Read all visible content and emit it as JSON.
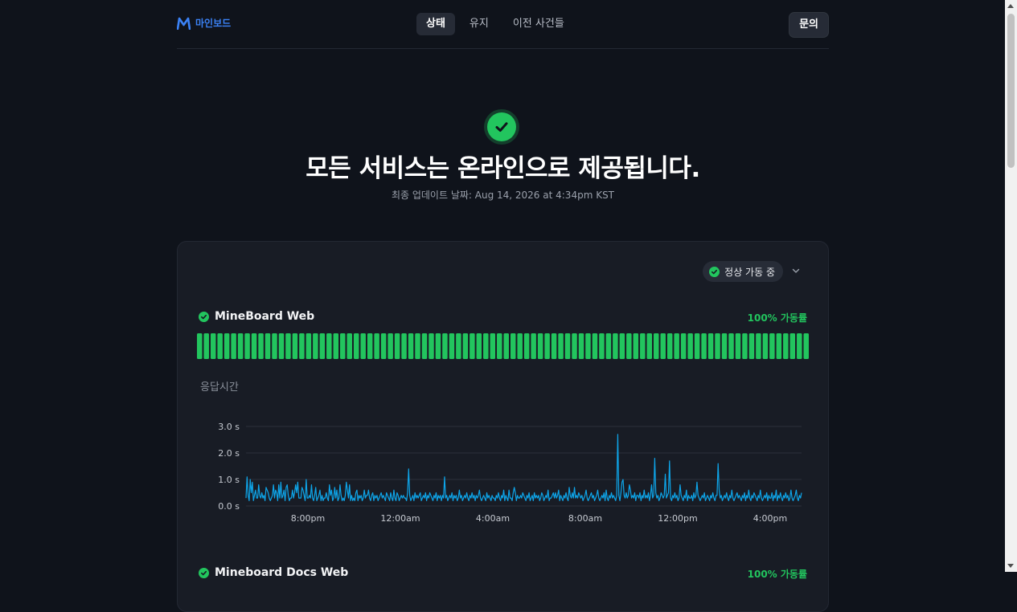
{
  "header": {
    "brand": "마인보드",
    "tabs": [
      {
        "label": "상태",
        "active": true
      },
      {
        "label": "유지",
        "active": false
      },
      {
        "label": "이전 사건들",
        "active": false
      }
    ],
    "contact_label": "문의"
  },
  "hero": {
    "title": "모든 서비스는 온라인으로 제공됩니다.",
    "last_updated": "최종 업데이트 날짜: Aug 14, 2026 at 4:34pm KST"
  },
  "card": {
    "status_filter": "정상 가동 중",
    "services": [
      {
        "name": "MineBoard Web",
        "uptime": "100% 가동률",
        "bar_count": 90,
        "status": "operational",
        "icon": "check-circle-icon"
      },
      {
        "name": "Mineboard Docs Web",
        "uptime": "100% 가동률",
        "status": "operational",
        "icon": "check-circle-icon"
      }
    ],
    "response_time_label": "응답시간"
  },
  "colors": {
    "background": "#0f131b",
    "card": "#181c25",
    "accent": "#3b82f6",
    "operational": "#22c55e",
    "line": "#0ea5e9"
  },
  "chart_data": {
    "type": "line",
    "title": "응답시간",
    "xlabel": "",
    "ylabel": "",
    "x_ticks": [
      "8:00pm",
      "12:00am",
      "4:00am",
      "8:00am",
      "12:00pm",
      "4:00pm"
    ],
    "y_ticks": [
      "0.0 s",
      "1.0 s",
      "2.0 s",
      "3.0 s"
    ],
    "ylim": [
      0,
      3
    ],
    "series": [
      {
        "values": [
          0.3,
          1.1,
          0.4,
          0.2,
          1.0,
          0.5,
          0.9,
          0.2,
          0.4,
          0.6,
          0.3,
          0.3,
          0.8,
          0.4,
          0.3,
          0.5,
          0.3,
          0.4,
          0.2,
          0.7,
          0.6,
          0.5,
          0.3,
          0.2,
          0.3,
          0.4,
          0.8,
          0.3,
          0.6,
          0.5,
          0.2,
          0.8,
          0.3,
          0.9,
          0.3,
          0.4,
          0.6,
          0.2,
          0.7,
          0.8,
          0.4,
          0.2,
          0.3,
          0.3,
          0.6,
          0.3,
          0.5,
          0.8,
          0.5,
          0.9,
          0.3,
          0.3,
          0.3,
          0.7,
          0.6,
          0.4,
          0.2,
          1.0,
          0.3,
          0.3,
          0.4,
          0.3,
          0.8,
          0.3,
          0.2,
          0.4,
          0.7,
          0.2,
          0.3,
          0.4,
          0.6,
          0.2,
          0.4,
          0.2,
          0.3,
          0.3,
          0.5,
          0.3,
          0.2,
          0.8,
          0.4,
          0.6,
          0.2,
          0.3,
          0.7,
          0.3,
          0.6,
          0.2,
          0.3,
          0.8,
          0.4,
          0.2,
          0.3,
          0.2,
          0.4,
          0.9,
          0.6,
          0.3,
          0.8,
          0.2,
          0.4,
          0.2,
          0.3,
          0.2,
          0.5,
          0.6,
          0.2,
          0.4,
          0.3,
          0.4,
          0.2,
          0.3,
          0.6,
          0.3,
          0.4,
          0.4,
          0.6,
          0.3,
          0.2,
          0.4,
          0.5,
          0.2,
          0.4,
          0.3,
          0.4,
          0.2,
          0.3,
          0.4,
          0.5,
          0.3,
          0.4,
          0.3,
          0.2,
          0.5,
          0.4,
          0.3,
          0.2,
          0.5,
          0.3,
          0.2,
          0.6,
          0.3,
          0.2,
          0.5,
          0.4,
          0.2,
          0.3,
          0.4,
          0.3,
          0.4,
          0.3,
          0.3,
          0.2,
          0.5,
          1.4,
          0.4,
          0.2,
          0.3,
          0.4,
          0.2,
          0.5,
          0.3,
          0.4,
          0.3,
          0.4,
          0.5,
          0.2,
          0.3,
          0.4,
          0.3,
          0.5,
          0.2,
          0.4,
          0.3,
          0.5,
          0.4,
          0.3,
          0.2,
          0.4,
          0.3,
          0.5,
          0.2,
          0.4,
          0.3,
          0.4,
          0.2,
          0.4,
          0.3,
          1.1,
          0.3,
          0.4,
          0.2,
          0.3,
          0.4,
          0.3,
          0.5,
          0.2,
          0.4,
          0.3,
          0.4,
          0.2,
          0.3,
          0.6,
          0.3,
          0.4,
          0.2,
          0.3,
          0.4,
          0.3,
          0.5,
          0.3,
          0.2,
          0.4,
          0.3,
          0.5,
          0.3,
          0.4,
          0.2,
          0.4,
          0.3,
          0.4,
          0.6,
          0.3,
          0.2,
          0.3,
          0.4,
          0.3,
          0.2,
          0.5,
          0.3,
          0.4,
          0.3,
          0.2,
          0.4,
          0.3,
          0.3,
          0.2,
          0.4,
          0.3,
          0.5,
          0.3,
          0.2,
          0.4,
          0.3,
          0.6,
          0.2,
          0.4,
          0.3,
          0.2,
          0.6,
          0.3,
          0.3,
          0.2,
          0.5,
          0.7,
          0.5,
          0.2,
          0.4,
          0.3,
          0.3,
          0.4,
          0.3,
          0.5,
          0.4,
          0.3,
          0.2,
          0.4,
          0.3,
          0.5,
          0.2,
          0.3,
          0.4,
          0.2,
          0.5,
          0.3,
          0.4,
          0.3,
          0.4,
          0.2,
          0.3,
          0.5,
          0.4,
          0.2,
          0.3,
          0.4,
          0.3,
          0.6,
          0.2,
          0.3,
          0.3,
          0.4,
          0.5,
          0.3,
          0.5,
          0.3,
          0.4,
          0.6,
          0.2,
          0.4,
          0.3,
          0.2,
          0.4,
          0.3,
          0.5,
          0.3,
          0.2,
          0.7,
          0.4,
          0.3,
          0.5,
          0.3,
          0.7,
          0.3,
          0.4,
          0.3,
          0.5,
          0.4,
          0.3,
          0.4,
          0.2,
          0.3,
          0.4,
          0.6,
          0.3,
          0.2,
          0.3,
          0.4,
          0.5,
          0.3,
          0.4,
          0.2,
          0.3,
          0.4,
          0.6,
          0.3,
          0.2,
          0.3,
          0.4,
          0.3,
          0.5,
          0.2,
          0.6,
          0.3,
          0.2,
          0.4,
          0.3,
          0.5,
          0.3,
          0.4,
          0.3,
          0.2,
          0.4,
          2.7,
          0.4,
          0.2,
          0.5,
          0.9,
          1.0,
          0.4,
          0.3,
          0.5,
          0.3,
          0.4,
          0.8,
          0.6,
          0.3,
          0.4,
          0.3,
          0.5,
          0.2,
          0.4,
          0.4,
          0.3,
          0.5,
          0.2,
          0.4,
          0.3,
          0.6,
          0.3,
          0.4,
          0.3,
          0.5,
          0.2,
          0.4,
          0.8,
          0.3,
          0.4,
          1.8,
          0.5,
          0.3,
          0.4,
          0.2,
          0.3,
          0.5,
          0.4,
          0.3,
          0.4,
          1.2,
          0.3,
          0.4,
          0.5,
          1.7,
          0.3,
          0.2,
          0.4,
          0.3,
          0.5,
          0.3,
          0.4,
          0.2,
          0.3,
          0.8,
          0.4,
          0.3,
          0.2,
          0.4,
          0.3,
          0.6,
          0.2,
          0.4,
          0.3,
          0.3,
          0.4,
          0.2,
          0.5,
          0.3,
          0.4,
          0.9,
          0.4,
          0.3,
          0.2,
          0.3,
          0.4,
          0.3,
          0.5,
          0.2,
          0.3,
          0.4,
          0.3,
          0.2,
          0.4,
          0.3,
          0.5,
          0.3,
          0.2,
          0.4,
          0.4,
          1.6,
          0.6,
          0.3,
          0.4,
          0.2,
          0.3,
          0.4,
          0.3,
          0.5,
          0.3,
          0.2,
          0.4,
          0.3,
          0.6,
          0.3,
          0.2,
          0.3,
          0.4,
          0.5,
          0.3,
          0.4,
          0.3,
          0.2,
          0.4,
          0.3,
          0.5,
          0.2,
          0.4,
          0.3,
          0.6,
          0.3,
          0.2,
          0.4,
          0.3,
          0.5,
          0.4,
          0.3,
          0.2,
          0.4,
          0.3,
          0.6,
          0.3,
          0.2,
          0.3,
          0.4,
          0.3,
          0.5,
          0.2,
          0.4,
          0.3,
          0.3,
          0.5,
          0.2,
          0.4,
          0.3,
          0.6,
          0.2,
          0.4,
          0.3,
          0.5,
          0.3,
          0.2,
          0.4,
          0.3,
          0.5,
          0.3,
          0.4,
          0.2,
          0.3,
          0.6,
          0.3,
          0.2,
          0.3,
          0.4,
          0.6,
          0.3,
          0.2,
          0.4,
          0.3,
          0.5
        ]
      }
    ]
  }
}
